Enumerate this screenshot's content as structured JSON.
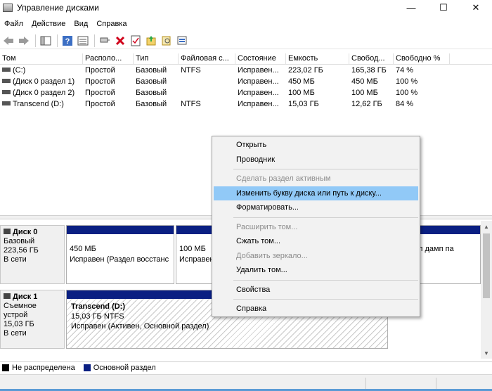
{
  "window": {
    "title": "Управление дисками",
    "minimize": "—",
    "maximize": "☐",
    "close": "✕"
  },
  "menubar": [
    "Файл",
    "Действие",
    "Вид",
    "Справка"
  ],
  "toolbar_icons": [
    "back-icon",
    "forward-icon",
    "console-tree-icon",
    "properties-icon",
    "help-icon",
    "disk-list-icon",
    "connect-icon",
    "delete-icon",
    "checklist-icon",
    "folder-icon",
    "search-icon",
    "export-icon"
  ],
  "volume_table": {
    "columns": [
      "Том",
      "Располо...",
      "Тип",
      "Файловая с...",
      "Состояние",
      "Емкость",
      "Свобод...",
      "Свободно %"
    ],
    "rows": [
      [
        "(C:)",
        "Простой",
        "Базовый",
        "NTFS",
        "Исправен...",
        "223,02 ГБ",
        "165,38 ГБ",
        "74 %"
      ],
      [
        "(Диск 0 раздел 1)",
        "Простой",
        "Базовый",
        "",
        "Исправен...",
        "450 МБ",
        "450 МБ",
        "100 %"
      ],
      [
        "(Диск 0 раздел 2)",
        "Простой",
        "Базовый",
        "",
        "Исправен...",
        "100 МБ",
        "100 МБ",
        "100 %"
      ],
      [
        "Transcend (D:)",
        "Простой",
        "Базовый",
        "NTFS",
        "Исправен...",
        "15,03 ГБ",
        "12,62 ГБ",
        "84 %"
      ]
    ]
  },
  "disks": [
    {
      "name": "Диск 0",
      "type": "Базовый",
      "size": "223,56 ГБ",
      "status": "В сети",
      "partitions": [
        {
          "size": "450 МБ",
          "status": "Исправен (Раздел восстанс"
        },
        {
          "size": "100 МБ",
          "status": "Исправен"
        },
        {
          "size": "",
          "status": "л дамп па"
        }
      ]
    },
    {
      "name": "Диск 1",
      "type": "Съемное устрой",
      "size": "15,03 ГБ",
      "status": "В сети",
      "partitions": [
        {
          "name": "Transcend  (D:)",
          "size": "15,03 ГБ NTFS",
          "status": "Исправен (Активен, Основной раздел)"
        }
      ]
    }
  ],
  "legend": [
    {
      "label": "Не распределена",
      "color": "#000000"
    },
    {
      "label": "Основной раздел",
      "color": "#0a1f82"
    }
  ],
  "context_menu": {
    "items": [
      {
        "label": "Открыть",
        "enabled": true
      },
      {
        "label": "Проводник",
        "enabled": true
      },
      {
        "sep": true
      },
      {
        "label": "Сделать раздел активным",
        "enabled": false
      },
      {
        "label": "Изменить букву диска или путь к диску...",
        "enabled": true,
        "highlight": true
      },
      {
        "label": "Форматировать...",
        "enabled": true
      },
      {
        "sep": true
      },
      {
        "label": "Расширить том...",
        "enabled": false
      },
      {
        "label": "Сжать том...",
        "enabled": true
      },
      {
        "label": "Добавить зеркало...",
        "enabled": false
      },
      {
        "label": "Удалить том...",
        "enabled": true
      },
      {
        "sep": true
      },
      {
        "label": "Свойства",
        "enabled": true
      },
      {
        "sep": true
      },
      {
        "label": "Справка",
        "enabled": true
      }
    ]
  }
}
